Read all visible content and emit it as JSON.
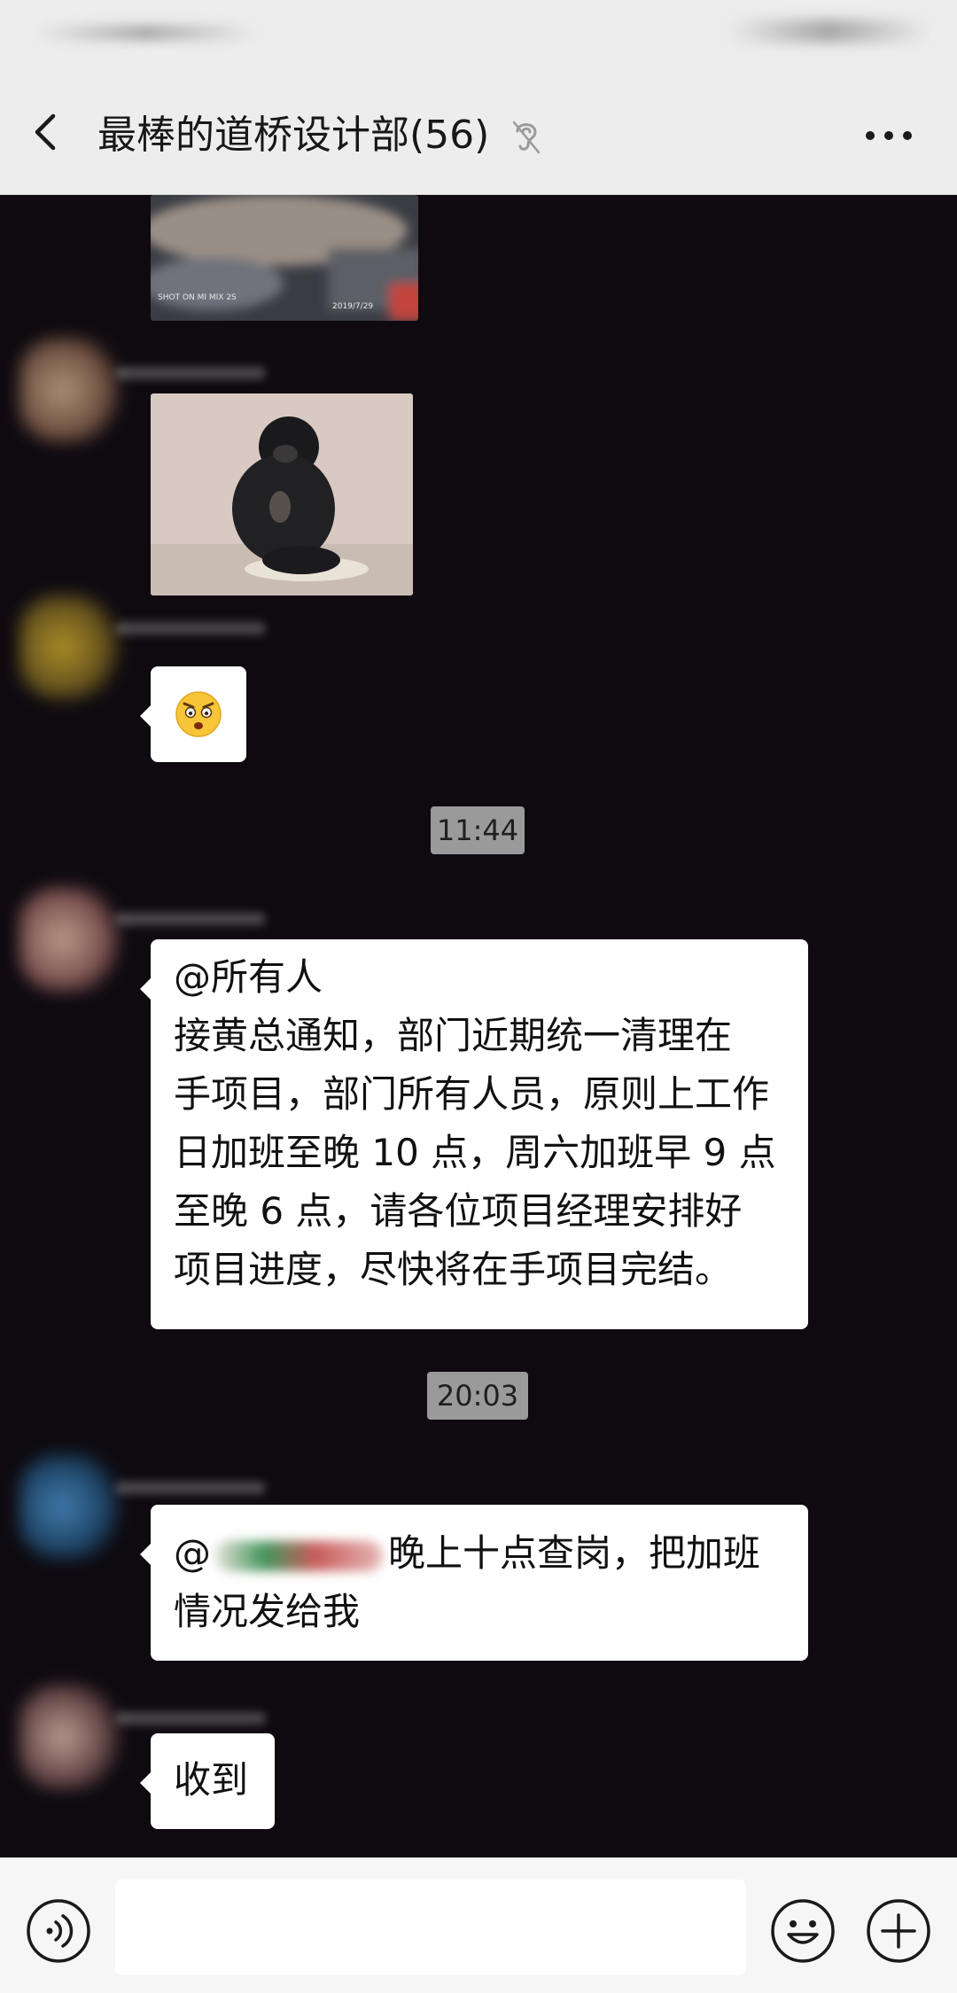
{
  "header": {
    "title": "最棒的道桥设计部(56)",
    "back_icon": "chevron-left-icon",
    "mute_icon": "ear-mute-icon",
    "more_icon": "more-dots-icon"
  },
  "chat": {
    "image_caption_1": "2019/7/29",
    "image_watermark_1": "SHOT ON MI MIX 2S",
    "emoji_reply_icon": "shocked-angry-face-emoji",
    "timestamps": [
      "11:44",
      "20:03"
    ],
    "messages": [
      {
        "lines": [
          "@所有人",
          "接黄总通知，部门近期统一清理在",
          "手项目，部门所有人员，原则上工作",
          "日加班至晚 10 点，周六加班早 9 点",
          "至晚 6 点，请各位项目经理安排好",
          "项目进度，尽快将在手项目完结。"
        ]
      },
      {
        "line1_prefix": "@",
        "line1_suffix": "晚上十点查岗，把加班",
        "line2": "情况发给我"
      },
      {
        "text": "收到"
      }
    ]
  },
  "input_bar": {
    "voice_icon": "voice-icon",
    "emoji_icon": "emoji-icon",
    "plus_icon": "plus-icon",
    "placeholder": ""
  },
  "colors": {
    "header_bg": "#ededed",
    "chat_bg": "#0e0a10",
    "bubble_bg": "#ffffff",
    "time_chip_bg": "#9a9a9a"
  }
}
